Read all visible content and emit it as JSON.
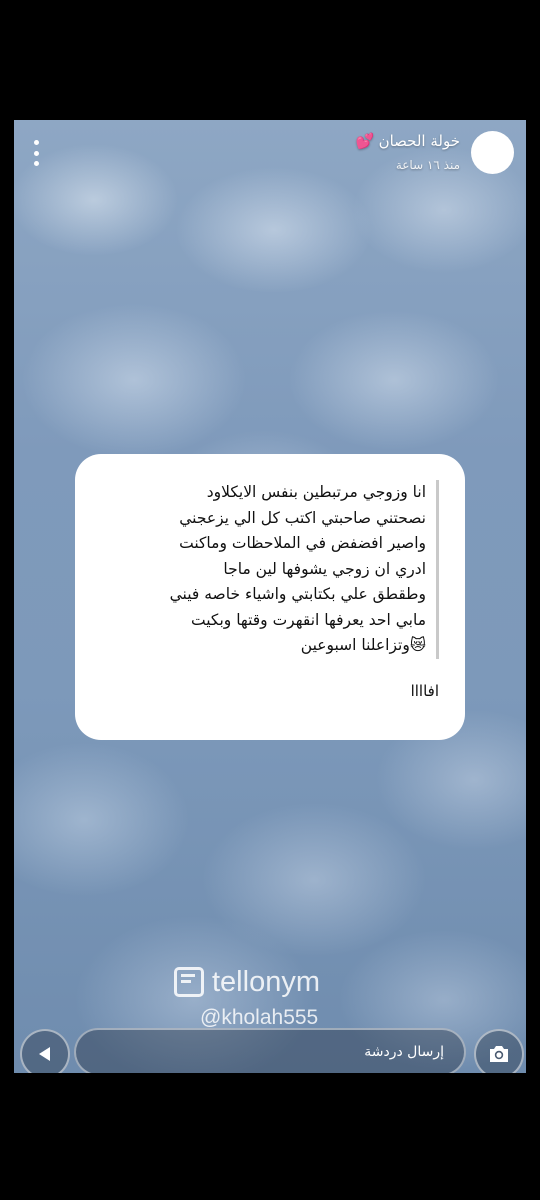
{
  "header": {
    "username": "خولة الحصان",
    "heart_emoji": "💕",
    "time_ago": "منذ ١٦ ساعة"
  },
  "card": {
    "question_lines": [
      "انا وزوجي مرتبطين بنفس الايكلاود",
      "نصحتني صاحبتي اكتب كل الي يزعجني",
      "واصير افضفض في الملاحظات وماكنت",
      "ادري ان زوجي يشوفها لين ماجا",
      "وطقطق علي بكتابتي واشياء خاصه فيني",
      "مابي احد يعرفها انقهرت وقتها وبكيت",
      "😿وتزاعلنا اسبوعين"
    ],
    "reply": "افاااا"
  },
  "brand": {
    "name": "tellonym",
    "handle": "@kholah555"
  },
  "footer": {
    "chat_placeholder": "إرسال دردشة"
  }
}
